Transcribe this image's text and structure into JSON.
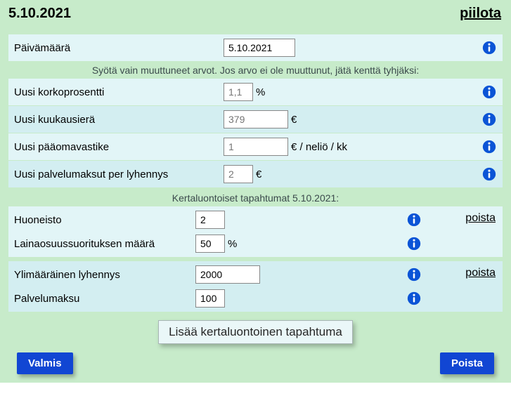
{
  "header": {
    "date": "5.10.2021",
    "hide": "piilota"
  },
  "instruct": "Syötä vain muuttuneet arvot. Jos arvo ei ole muuttunut, jätä kenttä tyhjäksi:",
  "fields": {
    "date": {
      "label": "Päivämäärä",
      "value": "5.10.2021"
    },
    "rate": {
      "label": "Uusi korkoprosentti",
      "placeholder": "1,1",
      "suffix": "%"
    },
    "monthly": {
      "label": "Uusi kuukausierä",
      "placeholder": "379",
      "suffix": "€"
    },
    "capital": {
      "label": "Uusi pääomavastike",
      "placeholder": "1",
      "suffix": "€ / neliö / kk"
    },
    "service": {
      "label": "Uusi palvelumaksut per lyhennys",
      "placeholder": "2",
      "suffix": "€"
    }
  },
  "events_header": "Kertaluontoiset tapahtumat 5.10.2021:",
  "events": [
    {
      "remove": "poista",
      "rows": [
        {
          "label": "Huoneisto",
          "value": "2",
          "suffix": ""
        },
        {
          "label": "Lainaosuussuorituksen määrä",
          "value": "50",
          "suffix": "%"
        }
      ]
    },
    {
      "remove": "poista",
      "rows": [
        {
          "label": "Ylimääräinen lyhennys",
          "value": "2000",
          "suffix": ""
        },
        {
          "label": "Palvelumaksu",
          "value": "100",
          "suffix": ""
        }
      ]
    }
  ],
  "add_button": "Lisää kertaluontoinen tapahtuma",
  "footer": {
    "done": "Valmis",
    "delete": "Poista"
  }
}
